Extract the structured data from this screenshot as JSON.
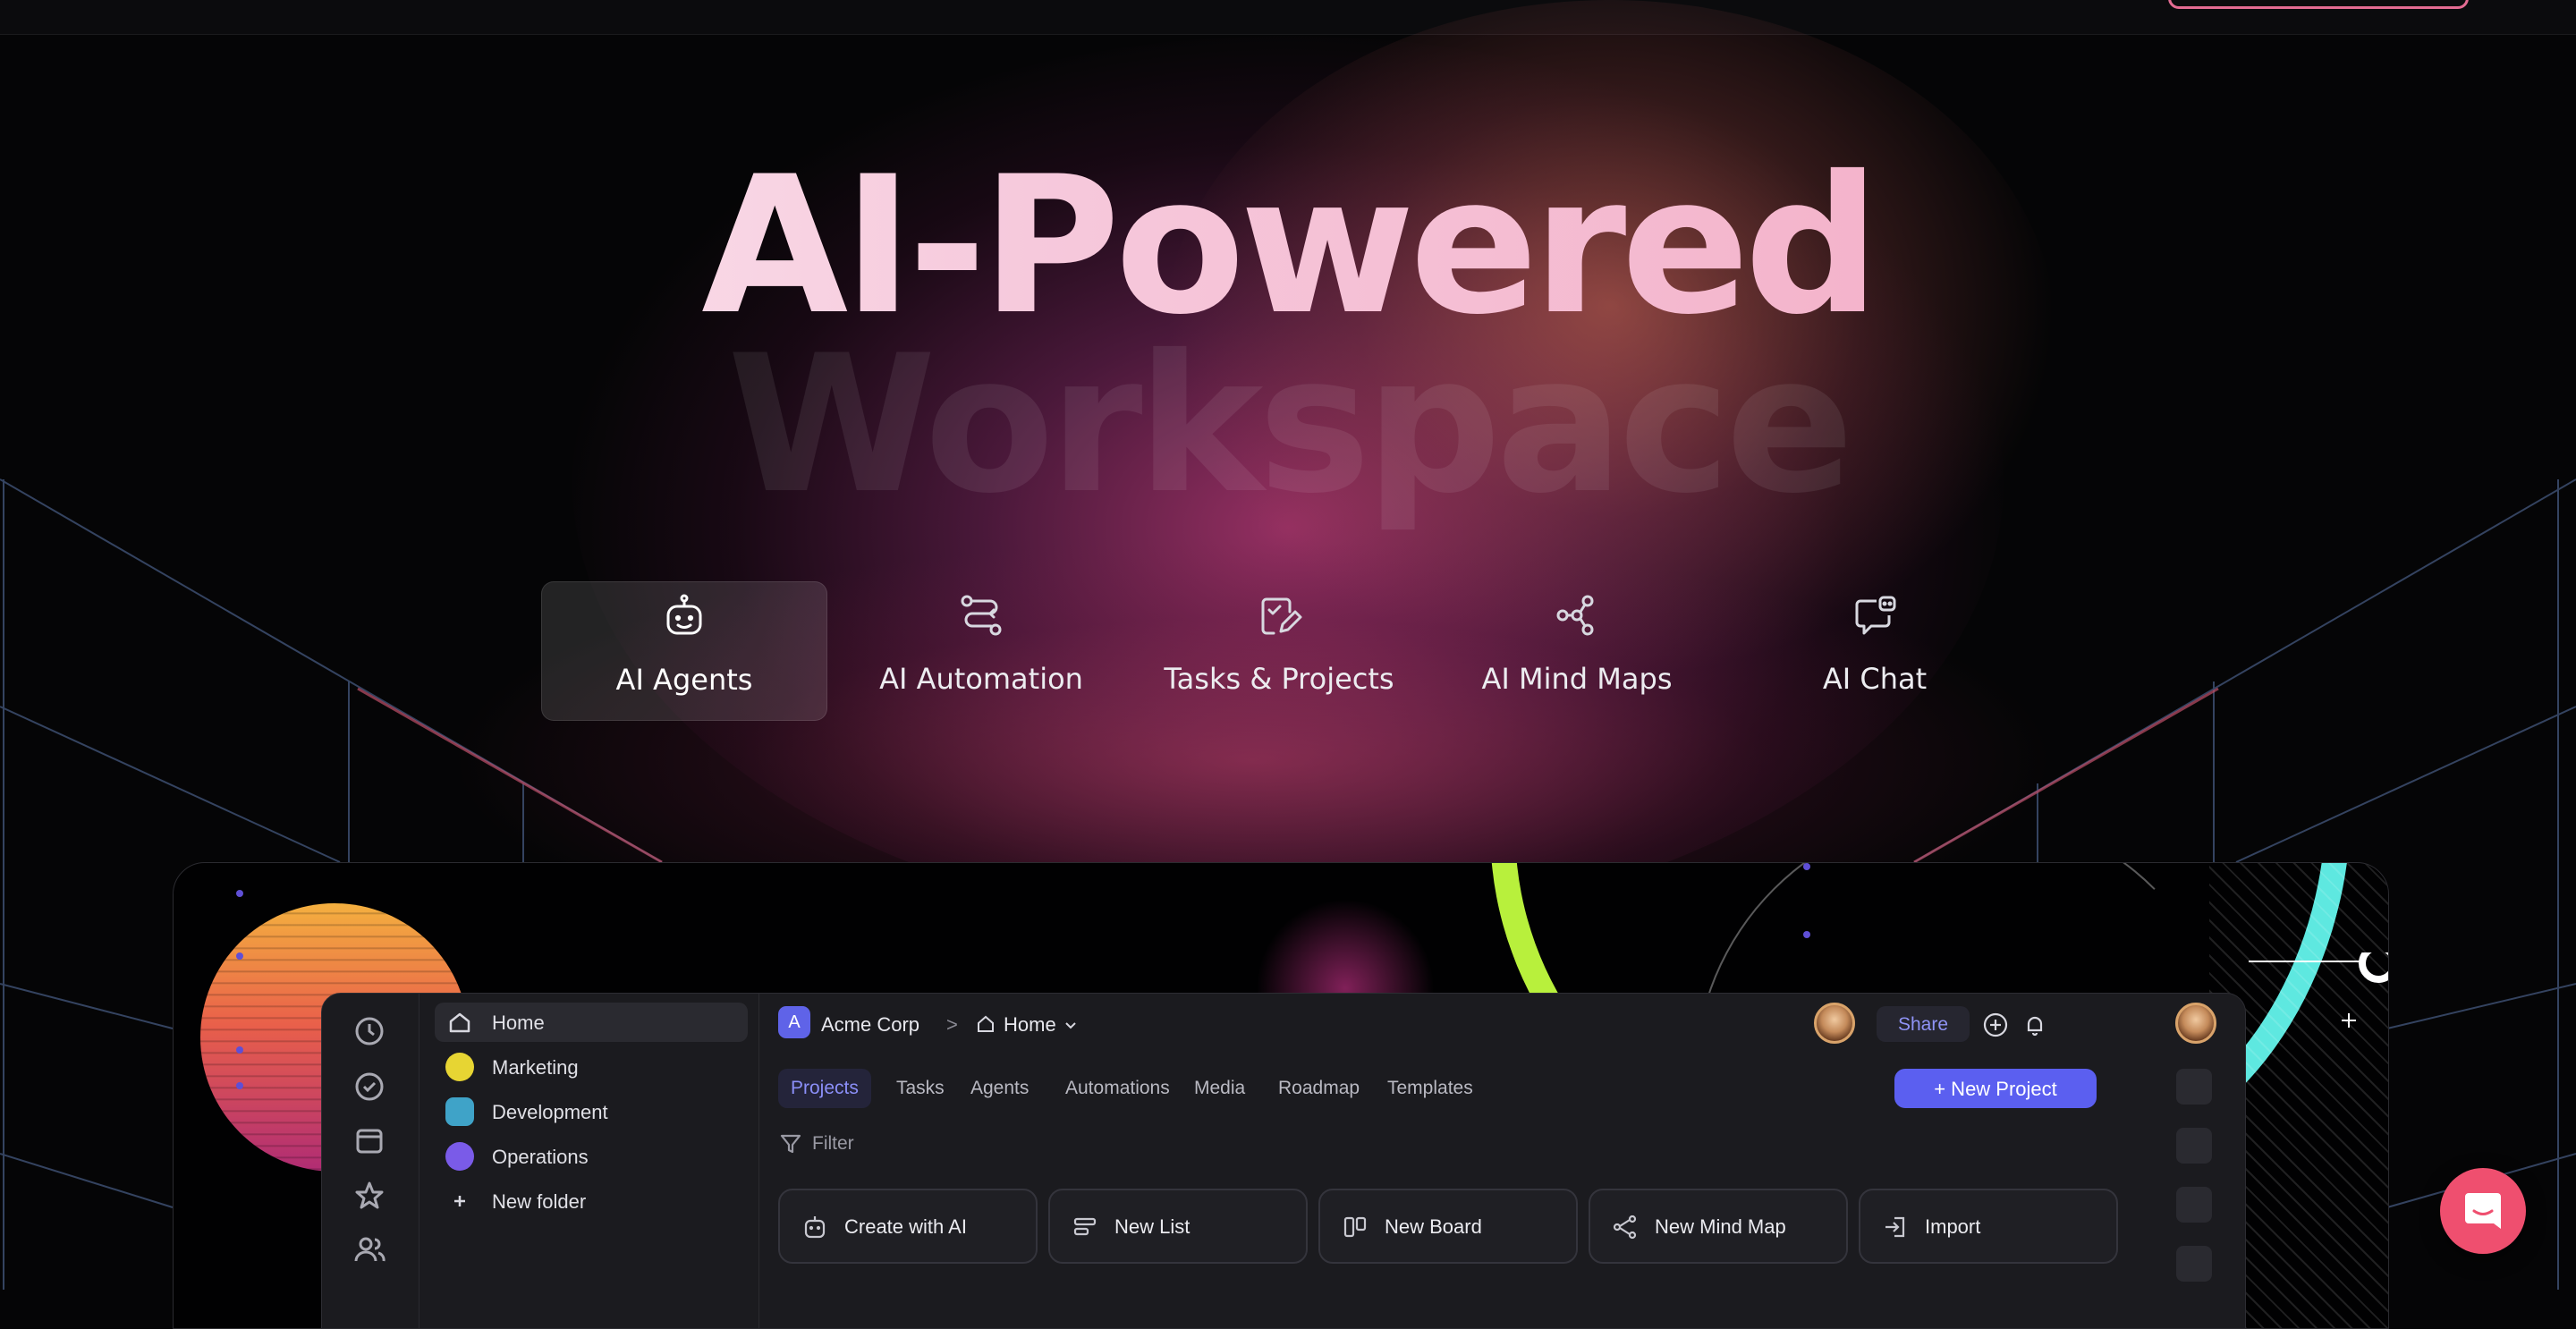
{
  "hero": {
    "line1": "AI-Powered",
    "line2": "Workspace"
  },
  "feature_tabs": [
    {
      "label": "AI Agents",
      "icon": "robot-icon",
      "active": true
    },
    {
      "label": "AI Automation",
      "icon": "automation-icon",
      "active": false
    },
    {
      "label": "Tasks & Projects",
      "icon": "task-checklist-icon",
      "active": false
    },
    {
      "label": "AI Mind Maps",
      "icon": "mind-map-icon",
      "active": false
    },
    {
      "label": "AI Chat",
      "icon": "chat-bot-icon",
      "active": false
    }
  ],
  "app": {
    "folders": [
      {
        "label": "Home",
        "icon": "home-icon",
        "active": true
      },
      {
        "label": "Marketing",
        "icon": "marketing-folder-icon",
        "color": "#e7d533"
      },
      {
        "label": "Development",
        "icon": "development-folder-icon",
        "color": "#3fa3c8"
      },
      {
        "label": "Operations",
        "icon": "operations-folder-icon",
        "color": "#7a5be8"
      },
      {
        "label": "New folder",
        "icon": "plus-icon"
      }
    ],
    "breadcrumb": {
      "workspace_initial": "A",
      "workspace": "Acme Corp",
      "separator": ">",
      "page": "Home"
    },
    "share_label": "Share",
    "subtabs": [
      "Projects",
      "Tasks",
      "Agents",
      "Automations",
      "Media",
      "Roadmap",
      "Templates"
    ],
    "active_subtab": "Projects",
    "new_project_label": "+ New Project",
    "filter_label": "Filter",
    "actions": [
      {
        "label": "Create with AI",
        "icon": "robot-icon"
      },
      {
        "label": "New List",
        "icon": "list-icon"
      },
      {
        "label": "New Board",
        "icon": "board-icon"
      },
      {
        "label": "New Mind Map",
        "icon": "mind-map-icon"
      },
      {
        "label": "Import",
        "icon": "import-icon"
      }
    ]
  },
  "colors": {
    "accent": "#5b5ff0",
    "brand_pink": "#ef4f6f",
    "active_tab_text": "#8b8ff8"
  }
}
